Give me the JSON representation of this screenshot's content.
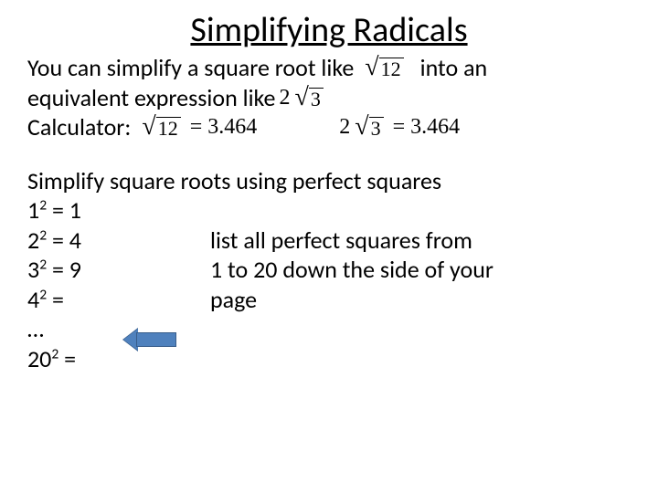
{
  "title": "Simplifying Radicals",
  "intro": {
    "part1": "You can simplify a square root like",
    "sqrt12": "12",
    "part2": "into an",
    "part3": "equivalent expression like",
    "coef2": "2",
    "sqrt3": "3"
  },
  "calc": {
    "label": "Calculator:",
    "sqrt12": "12",
    "eq1": "= 3.464",
    "coef2": "2",
    "sqrt3": "3",
    "eq2": "= 3.464"
  },
  "heading2": "Simplify square roots using perfect squares",
  "squares": {
    "l1base": "1",
    "l1exp": "2",
    "l1rest": " = 1",
    "l2base": "2",
    "l2exp": "2",
    "l2rest": " = 4",
    "l3base": "3",
    "l3exp": "2",
    "l3rest": " = 9",
    "l4base": "4",
    "l4exp": "2",
    "l4rest": " = ",
    "ellipsis": " …",
    "l5base": "20",
    "l5exp": "2",
    "l5rest": " ="
  },
  "instruction": {
    "line1": "list all perfect squares from",
    "line2": "1 to 20 down the side of your",
    "line3": "page"
  }
}
